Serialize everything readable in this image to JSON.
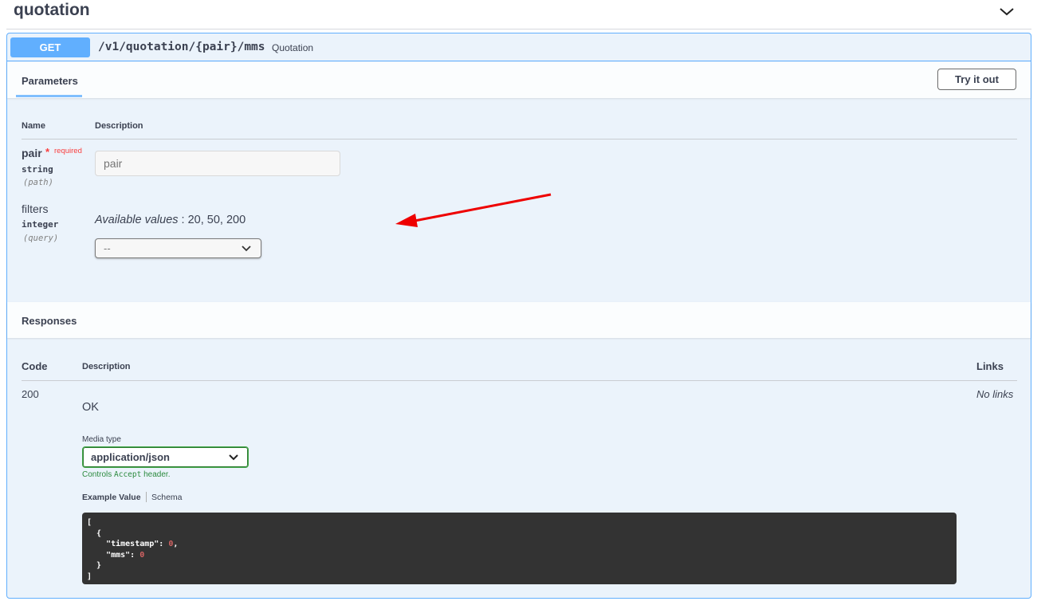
{
  "tag": {
    "title": "quotation",
    "chevron_icon": "chevron-down-icon"
  },
  "operation": {
    "method": "GET",
    "path": "/v1/quotation/{pair}/mms",
    "summary": "Quotation",
    "method_color": "#61affe"
  },
  "parameters": {
    "tab_label": "Parameters",
    "try_button": "Try it out",
    "col_name": "Name",
    "col_description": "Description",
    "items": [
      {
        "name": "pair",
        "required_star": "*",
        "required_text": "required",
        "type": "string",
        "in": "(path)",
        "placeholder": "pair"
      },
      {
        "name": "filters",
        "type": "integer",
        "in": "(query)",
        "available_label": "Available values",
        "available_values": " : 20, 50, 200",
        "selected": "--"
      }
    ]
  },
  "responses": {
    "title": "Responses",
    "col_code": "Code",
    "col_description": "Description",
    "col_links": "Links",
    "rows": [
      {
        "code": "200",
        "description": "OK",
        "links": "No links",
        "media_type_label": "Media type",
        "media_type": "application/json",
        "controls_prefix": "Controls ",
        "controls_code": "Accept",
        "controls_suffix": " header.",
        "tab_example": "Example Value",
        "tab_schema": "Schema",
        "example_lines": [
          "[",
          "  {",
          "    \"timestamp\": ",
          "    \"mms\": ",
          "  }",
          "]"
        ],
        "example_values": [
          "0",
          "0"
        ]
      }
    ]
  },
  "annotation": {
    "arrow_color": "#ee0000"
  }
}
